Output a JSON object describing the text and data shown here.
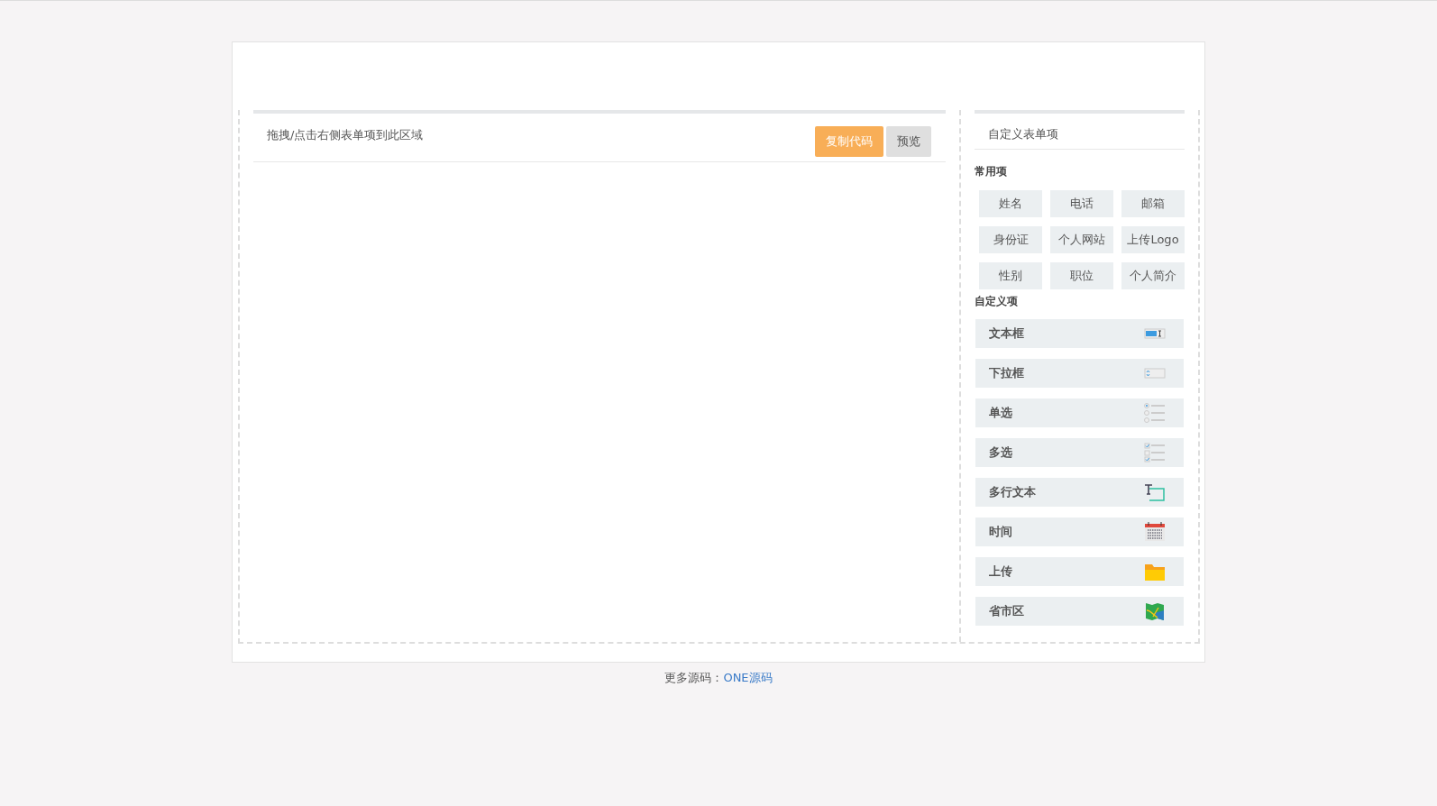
{
  "canvas": {
    "hint": "拖拽/点击右侧表单项到此区域",
    "buttons": [
      {
        "label": "复制代码",
        "kind": "primary"
      },
      {
        "label": "预览",
        "kind": "default"
      }
    ]
  },
  "panel": {
    "title": "自定义表单项",
    "common": {
      "heading": "常用项",
      "items": [
        "姓名",
        "电话",
        "邮箱",
        "身份证",
        "个人网站",
        "上传Logo",
        "性别",
        "职位",
        "个人简介"
      ]
    },
    "custom": {
      "heading": "自定义项",
      "items": [
        {
          "label": "文本框",
          "kind": "textbox"
        },
        {
          "label": "下拉框",
          "kind": "select"
        },
        {
          "label": "单选",
          "kind": "radio"
        },
        {
          "label": "多选",
          "kind": "checkbox"
        },
        {
          "label": "多行文本",
          "kind": "textarea"
        },
        {
          "label": "时间",
          "kind": "date"
        },
        {
          "label": "上传",
          "kind": "upload"
        },
        {
          "label": "省市区",
          "kind": "region"
        }
      ]
    }
  },
  "footer": {
    "text": "更多源码：",
    "link": "ONE源码"
  }
}
